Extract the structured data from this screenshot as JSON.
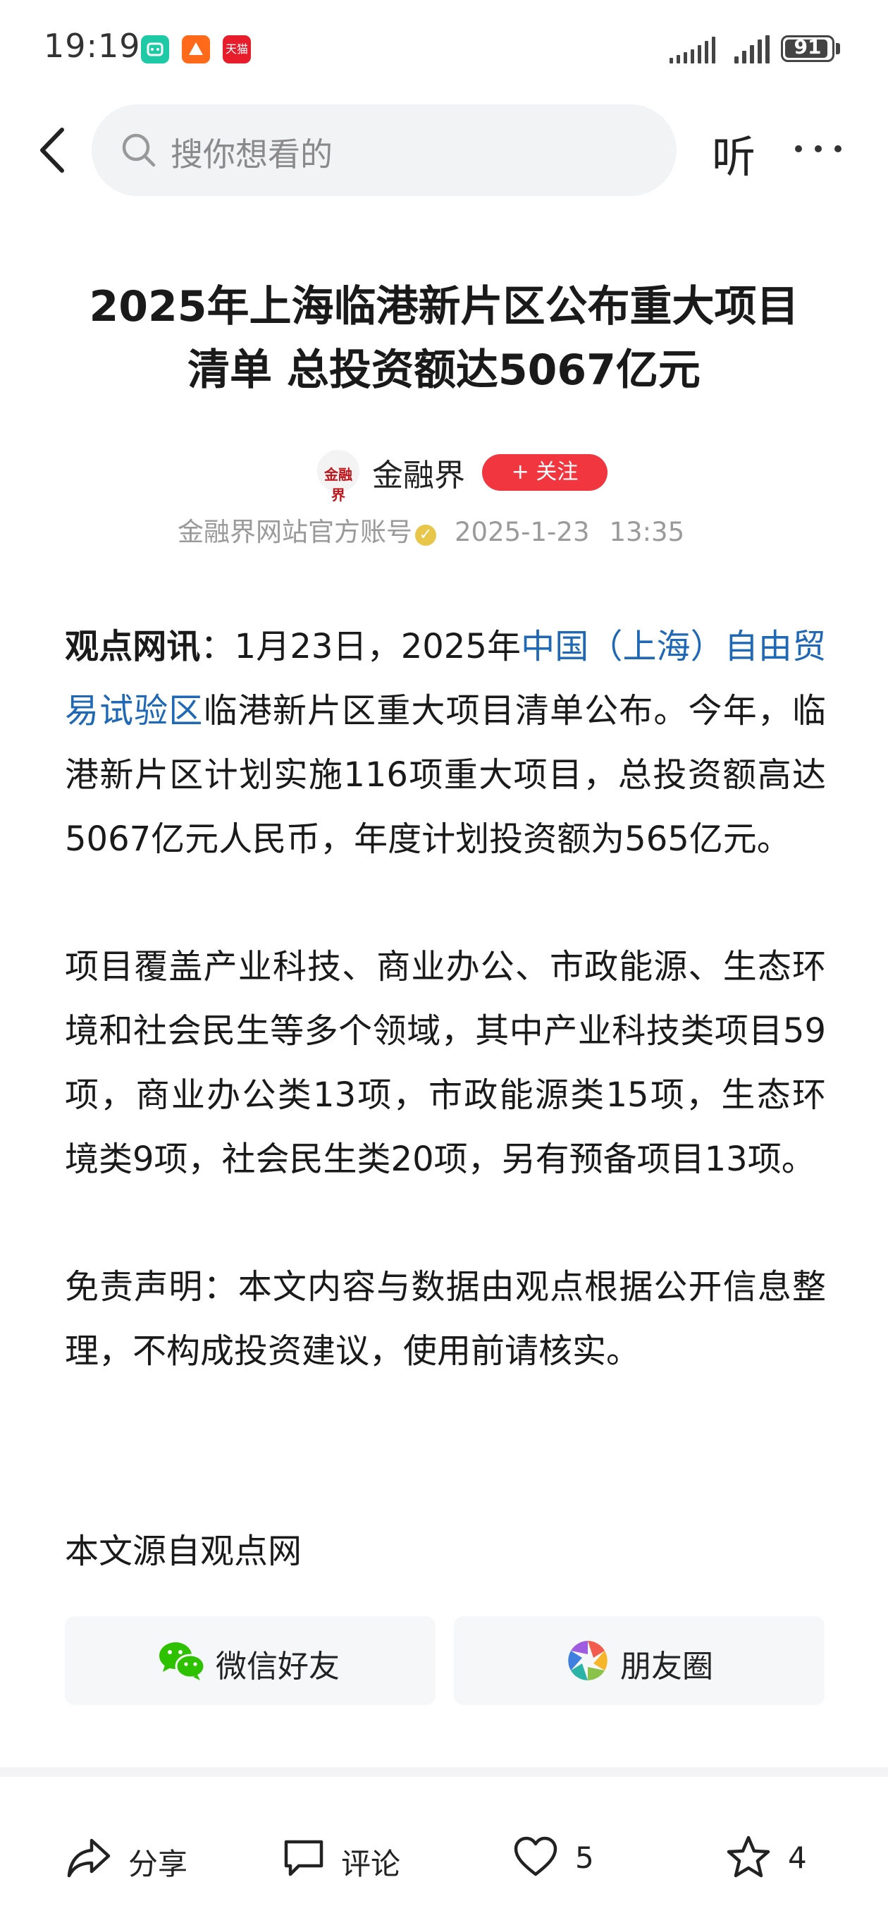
{
  "status_bar": {
    "time": "19:19",
    "app_icons": [
      "xiaomi-app-icon",
      "orange-app-icon",
      "tmall-app-icon"
    ],
    "tmall_icon_text": "天猫",
    "battery": "91"
  },
  "top_bar": {
    "search_placeholder": "搜你想看的",
    "listen_label": "听"
  },
  "article": {
    "title_line1": "2025年上海临港新片区公布重大项目",
    "title_line2": "清单 总投资额达5067亿元",
    "author": {
      "name": "金融界",
      "avatar_text": "金融界",
      "follow_label": "+ 关注",
      "account_desc": "金融界网站官方账号",
      "date": "2025-1-23",
      "time": "13:35"
    },
    "p1_lead": "观点网讯",
    "p1_text_a": "：1月23日，2025年",
    "p1_link": "中国（上海）自由贸易试验区",
    "p1_text_b": "临港新片区重大项目清单公布。今年，临港新片区计划实施116项重大项目，总投资额高达5067亿元人民币，年度计划投资额为565亿元。",
    "p2": "项目覆盖产业科技、商业办公、市政能源、生态环境和社会民生等多个领域，其中产业科技类项目59项，商业办公类13项，市政能源类15项，生态环境类9项，社会民生类20项，另有预备项目13项。",
    "p3": "免责声明：本文内容与数据由观点根据公开信息整理，不构成投资建议，使用前请核实。",
    "source": "本文源自观点网"
  },
  "share": {
    "wechat_label": "微信好友",
    "moments_label": "朋友圈"
  },
  "actions": {
    "share_label": "分享",
    "comment_label": "评论",
    "like_count": "5",
    "favorite_count": "4"
  },
  "colors": {
    "link": "#1f68b6",
    "follow_button": "#f2363f",
    "wechat_green": "#2dc100"
  }
}
